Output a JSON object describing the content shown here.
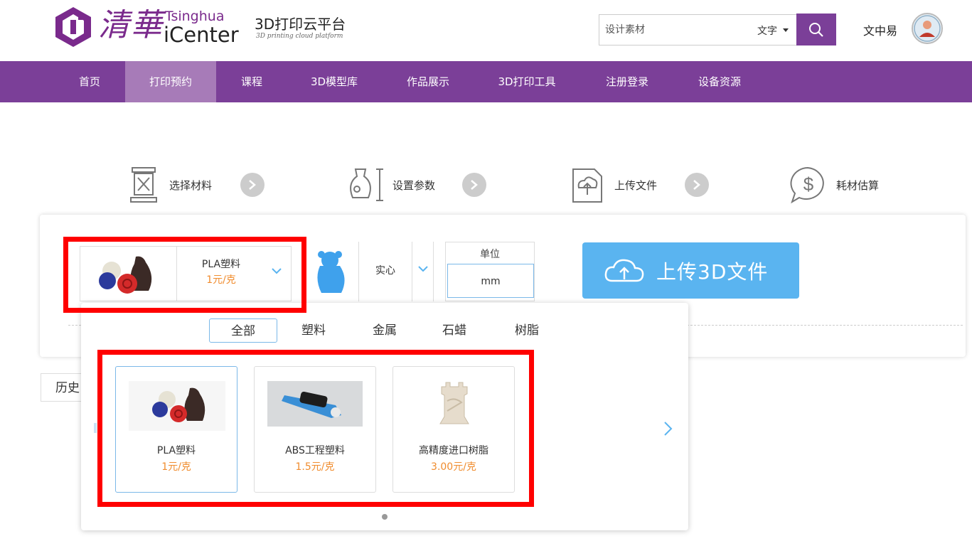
{
  "header": {
    "logo_hanzi": "清華",
    "logo_en_top": "Tsinghua",
    "logo_en_bottom": "iCenter",
    "platform_title": "3D打印云平台",
    "platform_subtitle": "3D printing cloud platform",
    "search": {
      "placeholder": "设计素材",
      "lang_label": "文字"
    },
    "username": "文中易"
  },
  "nav": {
    "items": [
      {
        "label": "首页",
        "active": false
      },
      {
        "label": "打印预约",
        "active": true
      },
      {
        "label": "课程",
        "active": false
      },
      {
        "label": "3D模型库",
        "active": false
      },
      {
        "label": "作品展示",
        "active": false
      },
      {
        "label": "3D打印工具",
        "active": false
      },
      {
        "label": "注册登录",
        "active": false
      },
      {
        "label": "设备资源",
        "active": false
      }
    ]
  },
  "steps": [
    {
      "label": "选择材料",
      "icon": "printer-icon"
    },
    {
      "label": "设置参数",
      "icon": "vase-dimension-icon"
    },
    {
      "label": "上传文件",
      "icon": "upload-doc-icon"
    },
    {
      "label": "耗材估算",
      "icon": "dollar-bubble-icon"
    }
  ],
  "config": {
    "material": {
      "name": "PLA塑料",
      "price": "1元/克"
    },
    "infill": {
      "value": "实心"
    },
    "unit": {
      "label": "单位",
      "value": "mm"
    },
    "upload_label": "上传3D文件",
    "history_label": "历史"
  },
  "dropdown": {
    "filters": [
      {
        "label": "全部",
        "active": true
      },
      {
        "label": "塑料",
        "active": false
      },
      {
        "label": "金属",
        "active": false
      },
      {
        "label": "石蜡",
        "active": false
      },
      {
        "label": "树脂",
        "active": false
      }
    ],
    "cards": [
      {
        "name": "PLA塑料",
        "price": "1元/克",
        "selected": true
      },
      {
        "name": "ABS工程塑料",
        "price": "1.5元/克",
        "selected": false
      },
      {
        "name": "高精度进口树脂",
        "price": "3.00元/克",
        "selected": false
      }
    ]
  },
  "colors": {
    "brand_purple": "#7b3f98",
    "nav_active": "#a77bb8",
    "price_orange": "#f08c2e",
    "upload_blue": "#5ab4f0",
    "annotation_red": "#ff0000"
  }
}
